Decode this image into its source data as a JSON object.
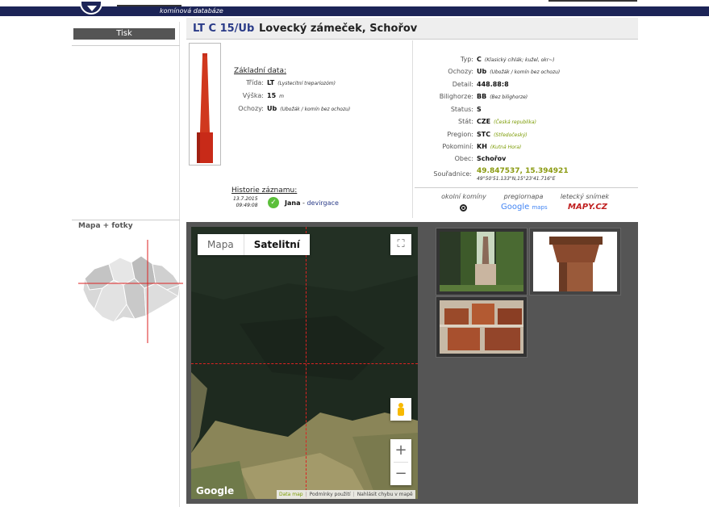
{
  "header": {
    "subtitle": "komínová databáze"
  },
  "sidebar": {
    "print_label": "Tisk",
    "map_photos_label": "Mapa + fotky"
  },
  "title": {
    "code": "LT C 15/Ub",
    "name": "Lovecký zámeček, Schořov"
  },
  "basic": {
    "heading": "Základní data:",
    "rows": [
      {
        "label": "Třída:",
        "value": "LT",
        "desc": "(Lystecitní treparíozóm)"
      },
      {
        "label": "Výška:",
        "value": "15",
        "desc": "m"
      },
      {
        "label": "Ochozy:",
        "value": "Ub",
        "desc": "(Ubožák / komín bez ochozu)"
      }
    ]
  },
  "history": {
    "heading": "Historie záznamu:",
    "date": "13.7.2015",
    "time": "09:49:08",
    "user": "Jana",
    "action": "devirgace"
  },
  "details": [
    {
      "label": "Typ:",
      "value": "C",
      "desc": "(Klasický cihlák; kužel, okr~)",
      "desc_color": "normal"
    },
    {
      "label": "Ochozy:",
      "value": "Ub",
      "desc": "(Ubožák / komín bez ochozu)",
      "desc_color": "normal"
    },
    {
      "label": "Detail:",
      "value": "448.88:8",
      "desc": "",
      "desc_color": "normal"
    },
    {
      "label": "Bilighorze:",
      "value": "BB",
      "desc": "(Bez bilighorze)",
      "desc_color": "normal"
    },
    {
      "label": "Status:",
      "value": "S",
      "desc": "",
      "desc_color": "normal"
    },
    {
      "label": "Stát:",
      "value": "CZE",
      "desc": "(Česká republika)",
      "desc_color": "green"
    },
    {
      "label": "Pregion:",
      "value": "STC",
      "desc": "(Středočeský)",
      "desc_color": "green"
    },
    {
      "label": "Pokominí:",
      "value": "KH",
      "desc": "(Kutná Hora)",
      "desc_color": "green"
    },
    {
      "label": "Obec:",
      "value": "Schořov",
      "desc": "",
      "desc_color": "normal"
    }
  ],
  "coordinates": {
    "label": "Souřadnice:",
    "decimal": "49.847537, 15.394921",
    "dms": "49°50'51.133\"N,15°23'41.716\"E"
  },
  "map_links": {
    "nearby": "okolní komíny",
    "pregion_map": "pregiornapa",
    "aerial": "letecký snímek",
    "google_text": "Google",
    "google_sub": "maps",
    "mapycz_text": "MAPY.CZ"
  },
  "map": {
    "type_map": "Mapa",
    "type_satellite": "Satelitní",
    "zoom_in": "+",
    "zoom_out": "−",
    "watermark": "Google",
    "footer_data": "Data map",
    "footer_terms": "Podmínky použití",
    "footer_report": "Nahlásit chybu v mapě"
  },
  "colors": {
    "navy": "#1c2457",
    "link_blue": "#2a3b88",
    "coord_green": "#8a9a10",
    "chimney_red": "#c8301c"
  }
}
